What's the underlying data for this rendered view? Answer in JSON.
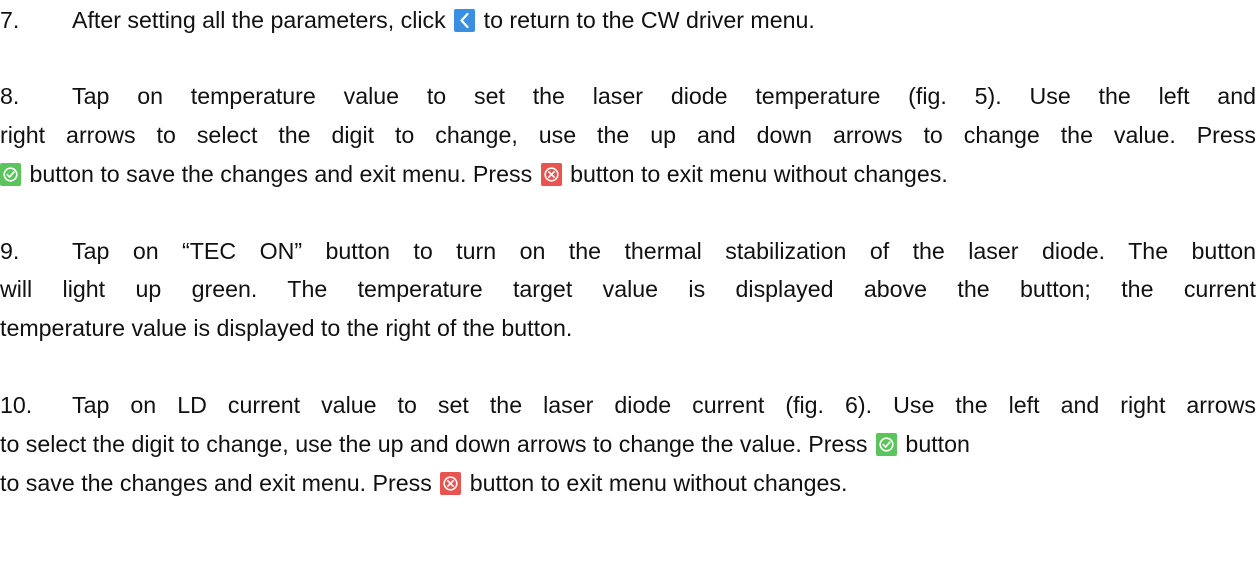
{
  "steps": [
    {
      "number": "7.",
      "parts": [
        "After setting all the parameters, click",
        "to return to the CW driver menu."
      ]
    },
    {
      "number": "8.",
      "line1": "Tap on temperature value to set the laser diode temperature (fig. 5). Use the left and",
      "line2": "right arrows to select the digit to change, use the up and down arrows to change the value. Press",
      "line3": [
        "button to save the changes and exit menu. Press",
        "button to exit menu without changes."
      ]
    },
    {
      "number": "9.",
      "line1": "Tap on “TEC ON” button to turn on the thermal stabilization of the laser diode. The button",
      "line2": "will light up green. The temperature target value is displayed above the button; the current",
      "line3": "temperature value is displayed to the right of the button."
    },
    {
      "number": "10.",
      "line1": "Tap on LD current value to set the laser diode current (fig. 6). Use the left and right arrows",
      "line2": [
        "to select the digit to change, use the up and down arrows to change the value. Press",
        "button"
      ],
      "line3": [
        "to save the changes and exit menu.  Press",
        "button to exit menu without changes."
      ]
    }
  ],
  "icons": {
    "back": {
      "name": "back-chevron-icon",
      "color": "#3b8fe0"
    },
    "confirm": {
      "name": "check-circle-icon",
      "color": "#5cc45c"
    },
    "cancel": {
      "name": "x-circle-icon",
      "color": "#e8544e"
    }
  }
}
